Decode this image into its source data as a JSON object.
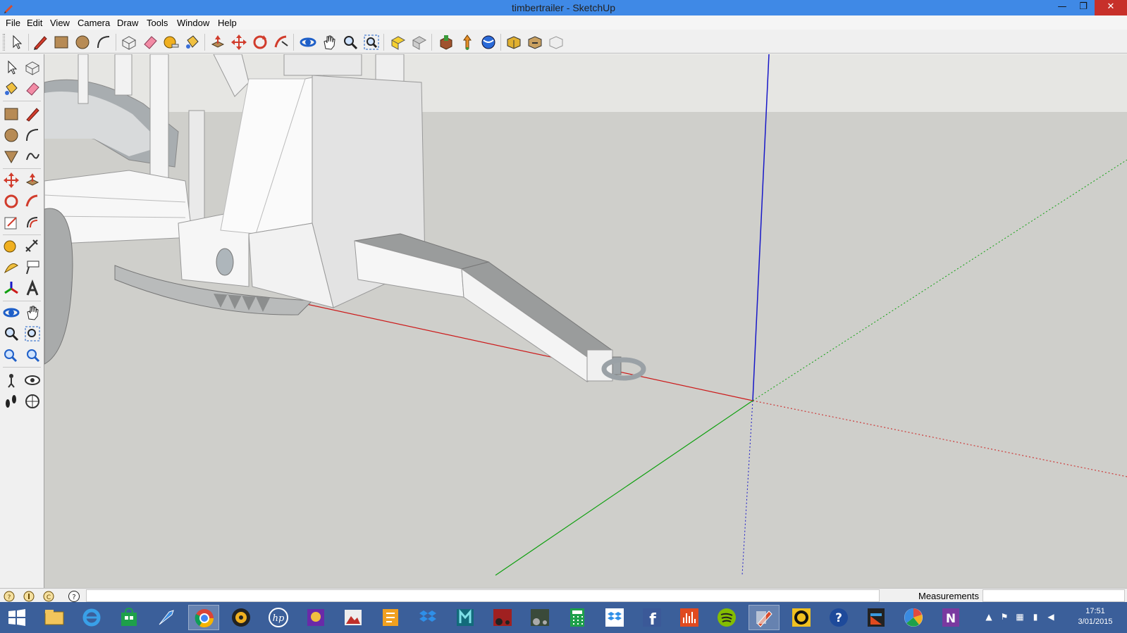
{
  "window": {
    "title": "timbertrailer - SketchUp",
    "app_icon": "sketchup-pencil-icon",
    "minimize_icon": "minimize-icon",
    "restore_icon": "restore-icon",
    "close_icon": "close-icon",
    "minimize_glyph": "—",
    "restore_glyph": "❐",
    "close_glyph": "✕"
  },
  "menu": {
    "items": [
      "File",
      "Edit",
      "View",
      "Camera",
      "Draw",
      "Tools",
      "Window",
      "Help"
    ]
  },
  "toolbar": {
    "tools": [
      "select",
      "line",
      "rectangle",
      "circle",
      "arc",
      "make-component",
      "eraser",
      "tape-measure",
      "paint-bucket",
      "push-pull",
      "move",
      "rotate",
      "follow-me",
      "orbit",
      "pan",
      "zoom",
      "zoom-extents",
      "previous-view",
      "next-view",
      "get-models",
      "share-model",
      "share-component",
      "get-models-alt",
      "preview-in-earth",
      "extension-warehouse",
      "extension-manager",
      "layout"
    ]
  },
  "palette": {
    "tools": [
      "select",
      "make-component",
      "paint-bucket",
      "eraser",
      "rectangle",
      "line",
      "circle",
      "arc",
      "polygon",
      "freehand",
      "move",
      "push-pull",
      "rotate",
      "follow-me",
      "scale",
      "offset",
      "tape-measure",
      "dimension",
      "protractor",
      "text",
      "axes",
      "3d-text",
      "orbit",
      "pan",
      "zoom",
      "zoom-window",
      "previous",
      "zoom-extents",
      "position-camera",
      "look-around",
      "walk",
      "section-plane"
    ]
  },
  "viewport": {
    "model_name": "timbertrailer",
    "axis_colors": {
      "red": "#cc1a1a",
      "green": "#10a010",
      "blue": "#1818c8"
    },
    "sky_color": "#e6e6e3",
    "ground_color": "#cfcfcb"
  },
  "statusbar": {
    "status_text": "",
    "measurements_label": "Measurements",
    "measurements_value": "",
    "icons": [
      "geo-location-icon",
      "credits-icon",
      "copyright-icon",
      "help-icon"
    ]
  },
  "taskbar": {
    "apps": [
      "start",
      "file-explorer",
      "internet-explorer",
      "store",
      "skype-like",
      "chrome",
      "media-player",
      "hp",
      "game",
      "photo-viewer",
      "blender",
      "dropbox",
      "3ds-max",
      "farming-sim",
      "farming-sim-2",
      "calculator",
      "dropbox-alt",
      "facebook",
      "audio-app",
      "spotify",
      "sketchup",
      "circle-app",
      "help",
      "studio",
      "picasa",
      "onenote"
    ],
    "active_app": "sketchup",
    "clock_time": "17:51",
    "clock_date": "3/01/2015"
  }
}
